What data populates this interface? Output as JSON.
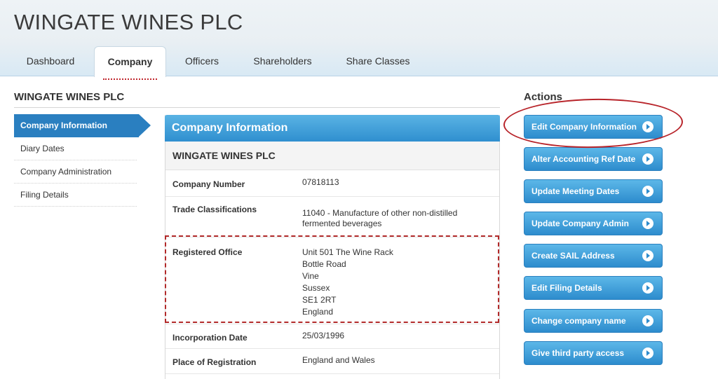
{
  "header": {
    "company_name": "WINGATE WINES PLC"
  },
  "tabs": [
    {
      "label": "Dashboard",
      "active": false
    },
    {
      "label": "Company",
      "active": true
    },
    {
      "label": "Officers",
      "active": false
    },
    {
      "label": "Shareholders",
      "active": false
    },
    {
      "label": "Share Classes",
      "active": false
    }
  ],
  "section": {
    "title": "WINGATE WINES PLC"
  },
  "sidenav": [
    {
      "label": "Company Information",
      "active": true
    },
    {
      "label": "Diary Dates",
      "active": false
    },
    {
      "label": "Company Administration",
      "active": false
    },
    {
      "label": "Filing Details",
      "active": false
    }
  ],
  "panel": {
    "heading": "Company Information",
    "subheading": "WINGATE WINES PLC",
    "company_number": {
      "label": "Company Number",
      "value": "07818113"
    },
    "trade_classifications": {
      "label": "Trade Classifications",
      "value": "11040 - Manufacture of other non-distilled fermented beverages"
    },
    "registered_office": {
      "label": "Registered Office",
      "lines": [
        "Unit 501 The Wine Rack",
        "Bottle Road",
        "Vine",
        "Sussex",
        "SE1 2RT",
        "England"
      ]
    },
    "incorporation_date": {
      "label": "Incorporation Date",
      "value": "25/03/1996"
    },
    "place_of_registration": {
      "label": "Place of Registration",
      "value": "England and Wales"
    }
  },
  "actions": {
    "title": "Actions",
    "buttons": [
      "Edit Company Information",
      "Alter Accounting Ref Date",
      "Update Meeting Dates",
      "Update Company Admin",
      "Create SAIL Address",
      "Edit Filing Details",
      "Change company name",
      "Give third party access"
    ]
  },
  "colors": {
    "accent": "#2d8ccd",
    "annotation": "#b8242a"
  }
}
